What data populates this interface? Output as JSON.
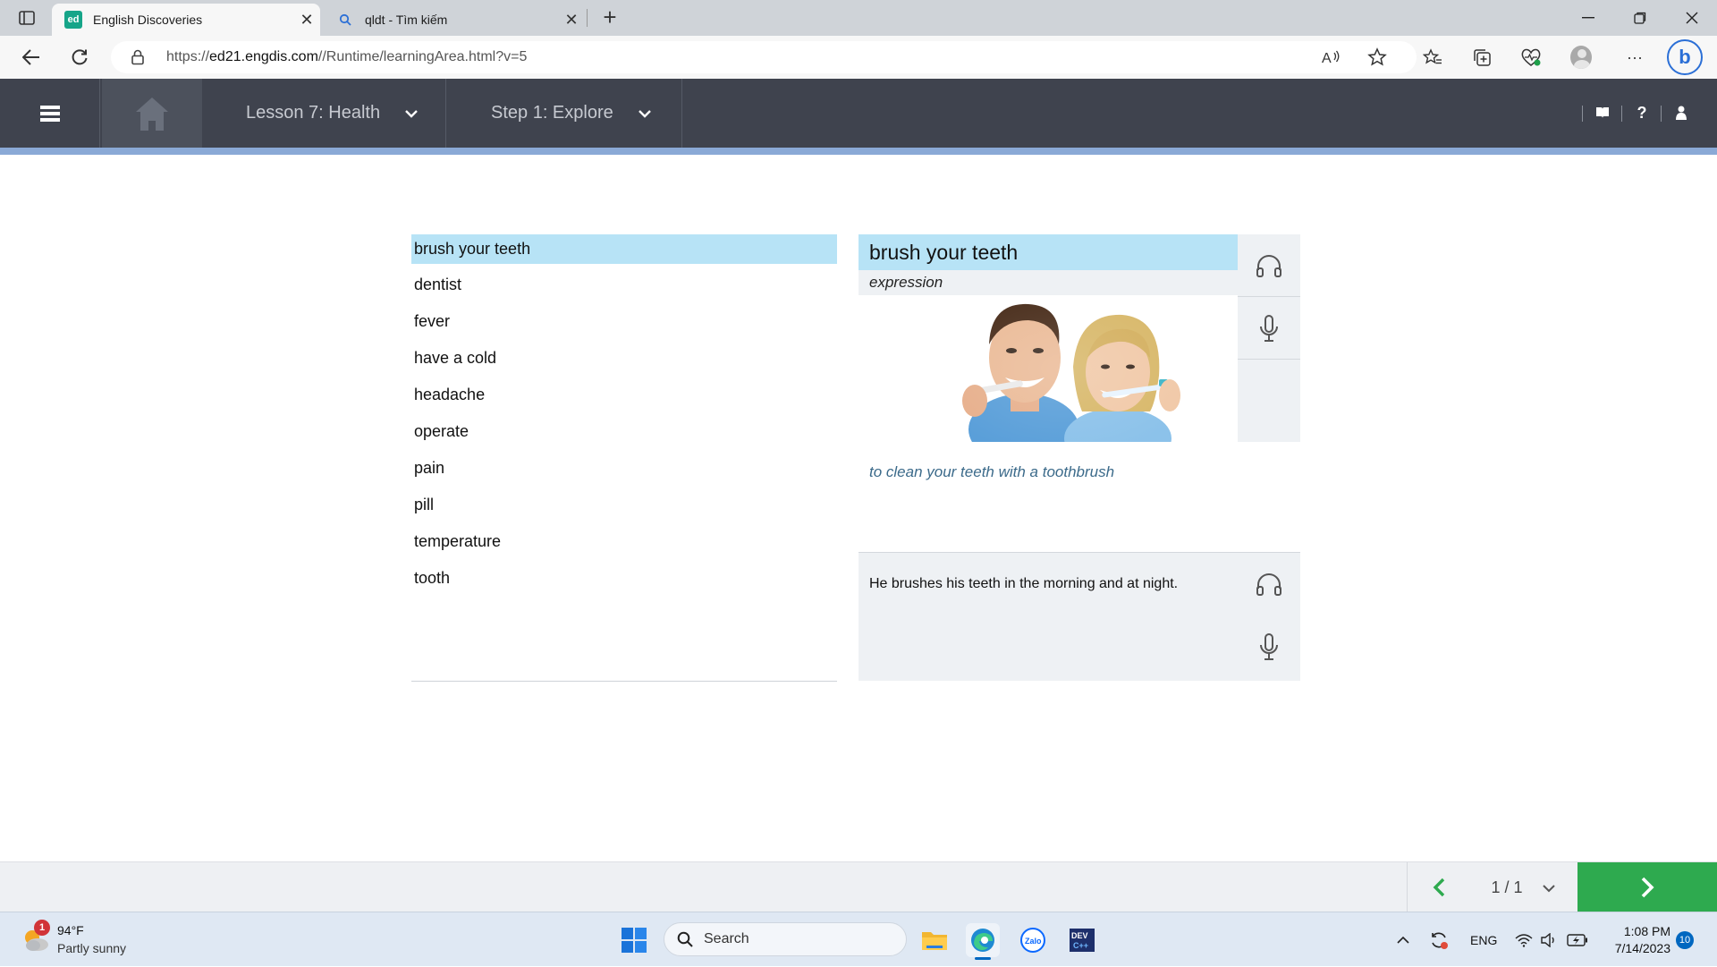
{
  "browser": {
    "tabs": [
      {
        "title": "English Discoveries",
        "favicon": "ed",
        "active": true
      },
      {
        "title": "qldt - Tìm kiếm",
        "active": false
      }
    ],
    "url_prefix": "https://",
    "url_host": "ed21.engdis.com",
    "url_path": "//Runtime/learningArea.html?v=5"
  },
  "app": {
    "lesson_label": "Lesson 7: Health",
    "step_label": "Step 1: Explore",
    "header_bg": "#3f434e",
    "accent_stripe": "#8aa9d6"
  },
  "wordlist": {
    "items": [
      "brush your teeth",
      "dentist",
      "fever",
      "have a cold",
      "headache",
      "operate",
      "pain",
      "pill",
      "temperature",
      "tooth"
    ],
    "selected": "brush your teeth",
    "highlight_color": "#b7e3f6"
  },
  "card": {
    "word": "brush your teeth",
    "part_of_speech": "expression",
    "definition": "to clean your teeth with a toothbrush",
    "example": "He brushes his teeth in the morning and at night."
  },
  "pager": {
    "label": "1 / 1"
  },
  "taskbar": {
    "weather_temp": "94°F",
    "weather_desc": "Partly sunny",
    "weather_badge": "1",
    "search_label": "Search",
    "lang": "ENG",
    "time": "1:08 PM",
    "date": "7/14/2023",
    "notifications": "10"
  }
}
